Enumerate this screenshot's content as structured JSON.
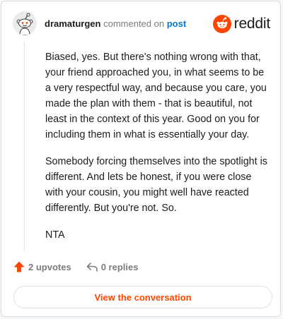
{
  "header": {
    "username": "dramaturgen",
    "action_text": "commented on",
    "post_link": "post",
    "brand_name": "reddit"
  },
  "comment": {
    "paragraphs": [
      "Biased, yes. But there's nothing wrong with that, your friend approached you, in what seems to be a very respectful way, and because you care, you made the plan with them - that is beautiful, not least in the context of this year. Good on you for including them in what is essentially your day.",
      "Somebody forcing themselves into the spotlight is different. And lets be honest, if you were close with your cousin, you might well have reacted differently. But you're not. So.",
      "NTA"
    ]
  },
  "actions": {
    "upvotes": "2 upvotes",
    "replies": "0 replies"
  },
  "footer": {
    "view_button": "View the conversation"
  },
  "icons": {
    "avatar": "snoo-avatar-icon",
    "logo": "reddit-logo-icon",
    "upvote": "upvote-arrow-icon",
    "reply": "reply-arrow-icon"
  },
  "colors": {
    "accent": "#ff4500",
    "link": "#0079d3",
    "text": "#1c1c1c",
    "muted": "#7c7c7c"
  }
}
